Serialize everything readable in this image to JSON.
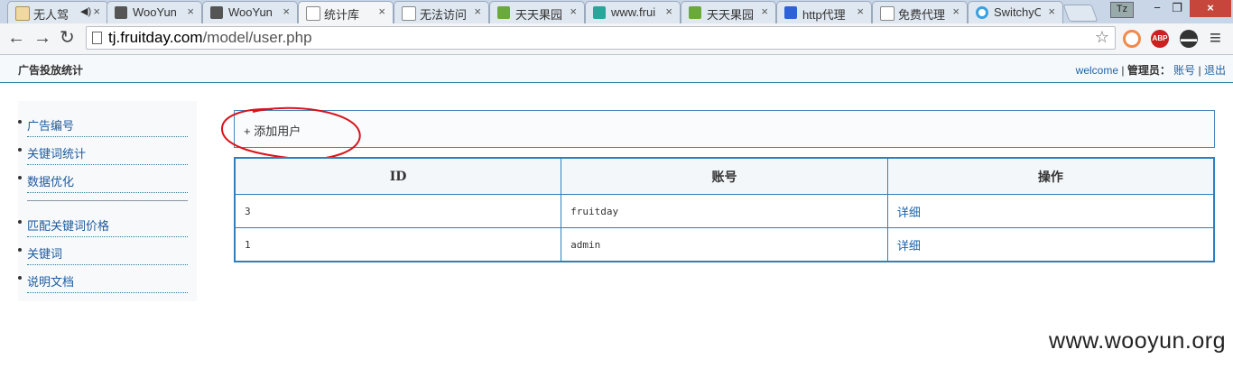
{
  "browser": {
    "tabs": [
      {
        "label": "无人驾",
        "favicon_color": "#f0d9a0",
        "active": false
      },
      {
        "label": "WooYun",
        "favicon_color": "#555555",
        "active": false
      },
      {
        "label": "WooYun",
        "favicon_color": "#555555",
        "active": false
      },
      {
        "label": "统计库",
        "favicon_color": "#ffffff",
        "active": true
      },
      {
        "label": "无法访问",
        "favicon_color": "#ffffff",
        "active": false
      },
      {
        "label": "天天果园",
        "favicon_color": "#6aaa3a",
        "active": false
      },
      {
        "label": "www.frui",
        "favicon_color": "#2aa59a",
        "active": false
      },
      {
        "label": "天天果园",
        "favicon_color": "#6aaa3a",
        "active": false
      },
      {
        "label": "http代理",
        "favicon_color": "#2f62d9",
        "active": false
      },
      {
        "label": "免费代理",
        "favicon_color": "#ffffff",
        "active": false
      },
      {
        "label": "SwitchyO",
        "favicon_color": "#3aa0e0",
        "active": false
      }
    ],
    "close_glyph": "×",
    "window_badge": "Tz",
    "window_controls": {
      "minimize": "−",
      "maximize": "❐",
      "close": "×"
    },
    "nav": {
      "back": "←",
      "forward": "→",
      "reload": "↻"
    },
    "url_host": "tj.fruitday.com",
    "url_path": "/model/user.php",
    "star_icon": "☆",
    "extensions": [
      {
        "name": "circle-icon",
        "color": "#f08a4b",
        "label": ""
      },
      {
        "name": "adblock-icon",
        "color": "#cc1f1f",
        "label": "ABP"
      },
      {
        "name": "incognito-icon",
        "color": "#333333",
        "label": ""
      }
    ],
    "menu_icon": "≡"
  },
  "header": {
    "site_title": "广告投放统计",
    "welcome": "welcome",
    "separator": " | ",
    "admin_label": "管理员：",
    "account_link": "账号",
    "logout_link": "退出"
  },
  "sidebar": {
    "group1": [
      "广告编号",
      "关键词统计",
      "数据优化"
    ],
    "group2": [
      "匹配关键词价格",
      "关键词",
      "说明文档"
    ]
  },
  "main": {
    "add_user": "+ 添加用户",
    "table": {
      "headers": [
        "ID",
        "账号",
        "操作"
      ],
      "rows": [
        {
          "id": "3",
          "account": "fruitday",
          "action": "详细"
        },
        {
          "id": "1",
          "account": "admin",
          "action": "详细"
        }
      ]
    }
  },
  "annotation_color": "#d8141a",
  "watermark": "www.wooyun.org"
}
